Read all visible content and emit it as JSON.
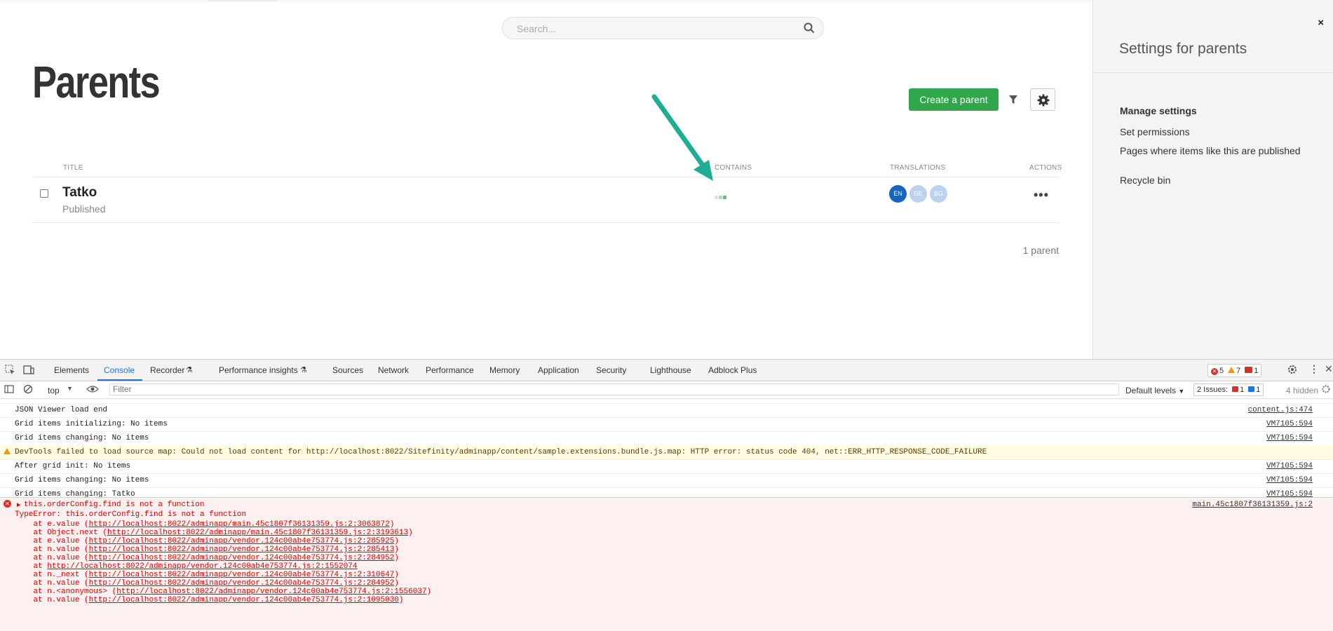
{
  "app": {
    "search_placeholder": "Search...",
    "page_title": "Parents",
    "create_button": "Create a parent",
    "columns": {
      "title": "TITLE",
      "contains": "CONTAINS",
      "translations": "TRANSLATIONS",
      "actions": "ACTIONS"
    },
    "rows": [
      {
        "title": "Tatko",
        "status": "Published",
        "translations": [
          "EN",
          "DE",
          "BG"
        ]
      }
    ],
    "count": "1 parent"
  },
  "panel": {
    "title": "Settings for parents",
    "close": "×",
    "manage_heading": "Manage settings",
    "links": [
      "Set permissions",
      "Pages where items like this are published",
      "Recycle bin"
    ]
  },
  "devtools": {
    "tabs": [
      "Elements",
      "Console",
      "Recorder",
      "Performance insights",
      "Sources",
      "Network",
      "Performance",
      "Memory",
      "Application",
      "Security",
      "Lighthouse",
      "Adblock Plus"
    ],
    "active_tab": "Console",
    "badge_errors": "5",
    "badge_warnings": "7",
    "badge_issues": "1",
    "context": "top",
    "filter_placeholder": "Filter",
    "levels": "Default levels",
    "issues_label": "2 Issues:",
    "issues_err": "1",
    "issues_info": "1",
    "hidden": "4 hidden",
    "console_lines": [
      {
        "msg": "JSON Viewer load end",
        "src": "content.js:474"
      },
      {
        "msg": "Grid items initializing: No items",
        "src": "VM7105:594"
      },
      {
        "msg": "Grid items changing: No items",
        "src": "VM7105:594"
      },
      {
        "msg_pre": "DevTools failed to load source map: Could not load content for ",
        "msg_link": "http://localhost:8022/Sitefinity/adminapp/content/sample.extensions.bundle.js.map",
        "msg_post": ": HTTP error: status code 404, net::ERR_HTTP_RESPONSE_CODE_FAILURE"
      },
      {
        "msg": "After grid init: No items",
        "src": "VM7105:594"
      },
      {
        "msg": "Grid items changing: No items",
        "src": "VM7105:594"
      },
      {
        "msg": "Grid items changing: Tatko",
        "src": "VM7105:594"
      }
    ],
    "error": {
      "summary": "this.orderConfig.find is not a function",
      "src": "main.45c1807f36131359.js:2",
      "type_line": "TypeError: this.orderConfig.find is not a function",
      "stack": [
        {
          "pre": "    at e.value (",
          "link": "http://localhost:8022/adminapp/main.45c1807f36131359.js:2:3063872",
          "post": ")"
        },
        {
          "pre": "    at Object.next (",
          "link": "http://localhost:8022/adminapp/main.45c1807f36131359.js:2:3193613",
          "post": ")"
        },
        {
          "pre": "    at e.value (",
          "link": "http://localhost:8022/adminapp/vendor.124c00ab4e753774.js:2:285925",
          "post": ")"
        },
        {
          "pre": "    at n.value (",
          "link": "http://localhost:8022/adminapp/vendor.124c00ab4e753774.js:2:285413",
          "post": ")"
        },
        {
          "pre": "    at n.value (",
          "link": "http://localhost:8022/adminapp/vendor.124c00ab4e753774.js:2:284952",
          "post": ")"
        },
        {
          "pre": "    at ",
          "link": "http://localhost:8022/adminapp/vendor.124c00ab4e753774.js:2:1552074",
          "post": ""
        },
        {
          "pre": "    at n._next (",
          "link": "http://localhost:8022/adminapp/vendor.124c00ab4e753774.js:2:310647",
          "post": ")"
        },
        {
          "pre": "    at n.value (",
          "link": "http://localhost:8022/adminapp/vendor.124c00ab4e753774.js:2:284952",
          "post": ")"
        },
        {
          "pre": "    at n.<anonymous> (",
          "link": "http://localhost:8022/adminapp/vendor.124c00ab4e753774.js:2:1556037",
          "post": ")"
        },
        {
          "pre": "    at n.value (",
          "link": "http://localhost:8022/adminapp/vendor.124c00ab4e753774.js:2:1095030",
          "post": ")"
        }
      ]
    }
  },
  "colors": {
    "accent_green": "#30a74a",
    "arrow_teal": "#1fae94",
    "devtools_blue": "#1a73e8",
    "error_red": "#d93025"
  }
}
